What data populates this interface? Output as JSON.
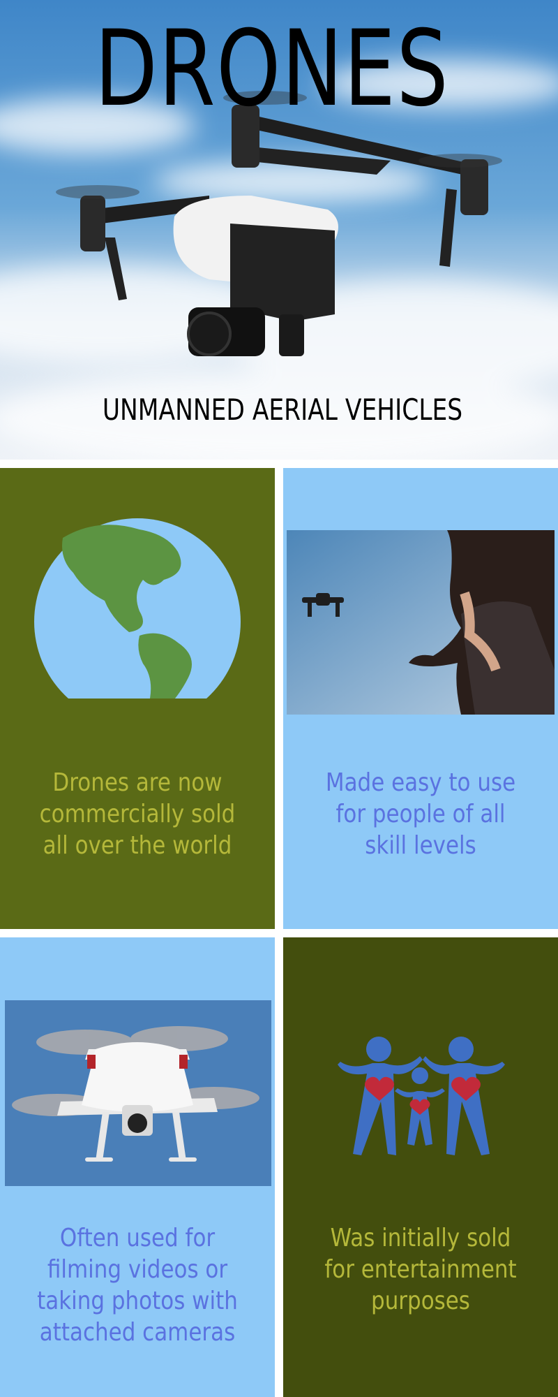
{
  "hero": {
    "title": "DRONES",
    "subtitle": "UNMANNED AERIAL VEHICLES"
  },
  "panels": [
    {
      "text": "Drones are now commercially sold all over the world",
      "icon": "globe-icon",
      "color": "#5a6a16"
    },
    {
      "text": "Made easy to use for people of all skill levels",
      "icon": "woman-flying-drone-photo",
      "color": "#8ec9f7"
    },
    {
      "text": "Often used for filming videos or taking photos with attached cameras",
      "icon": "white-quadcopter-photo",
      "color": "#8ec9f7"
    },
    {
      "text": "Was initially sold for entertainment purposes",
      "icon": "family-hearts-icon",
      "color": "#434e0d"
    }
  ],
  "colors": {
    "olive_text": "#b5b83a",
    "blue_text": "#5a72e0",
    "sky": "#4a8fd0"
  }
}
